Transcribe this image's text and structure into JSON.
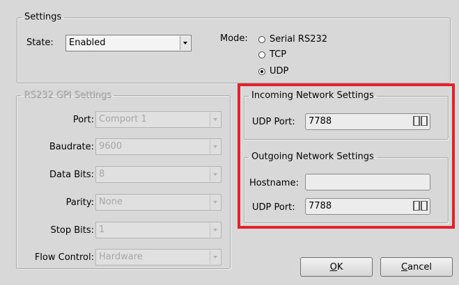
{
  "settings": {
    "legend": "Settings",
    "state_label": "State:",
    "state_value": "Enabled",
    "mode_label": "Mode:",
    "mode_options": [
      {
        "label": "Serial RS232",
        "selected": false
      },
      {
        "label": "TCP",
        "selected": false
      },
      {
        "label": "UDP",
        "selected": true
      }
    ]
  },
  "rs232": {
    "legend": "RS232 GPI Settings",
    "fields": [
      {
        "label": "Port:",
        "value": "Comport 1"
      },
      {
        "label": "Baudrate:",
        "value": "9600"
      },
      {
        "label": "Data Bits:",
        "value": "8"
      },
      {
        "label": "Parity:",
        "value": "None"
      },
      {
        "label": "Stop Bits:",
        "value": "1"
      },
      {
        "label": "Flow Control:",
        "value": "Hardware"
      }
    ]
  },
  "incoming": {
    "legend": "Incoming Network Settings",
    "udp_port_label": "UDP Port:",
    "udp_port_value": "7788"
  },
  "outgoing": {
    "legend": "Outgoing Network Settings",
    "hostname_label": "Hostname:",
    "hostname_value": "",
    "udp_port_label": "UDP Port:",
    "udp_port_value": "7788"
  },
  "buttons": {
    "ok_mnemonic": "O",
    "ok_rest": "K",
    "cancel_mnemonic": "C",
    "cancel_rest": "ancel"
  },
  "colors": {
    "highlight": "#e4202a",
    "background": "#d8d8d8"
  }
}
